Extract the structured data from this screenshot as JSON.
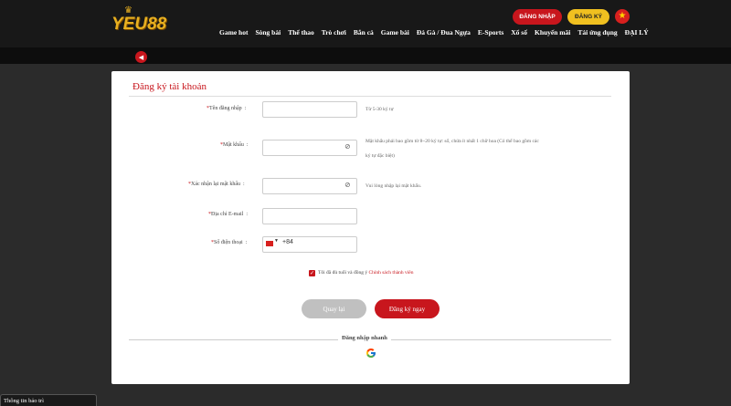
{
  "header": {
    "logo_text": "YEU88",
    "login_label": "ĐĂNG NHẬP",
    "register_label": "ĐĂNG KÝ",
    "nav": [
      "Game hot",
      "Sòng bài",
      "Thể thao",
      "Trò chơi",
      "Bắn cá",
      "Game bài",
      "Đá Gà / Đua Ngựa",
      "E-Sports",
      "Xổ số",
      "Khuyến mãi",
      "Tải ứng dụng",
      "ĐẠI LÝ"
    ]
  },
  "form": {
    "title": "Đăng ký tài khoản",
    "username_label": "Tên đăng nhập",
    "username_hint": "Từ 5-30 ký tự",
    "password_label": "Mật khẩu",
    "password_hint_1": "Mật khẩu phải bao gồm từ 8~20 ký tự: số, chứa ít nhất 1 chữ hoa (Có thể bao gồm các",
    "password_hint_2": "ký tự đặc biệt)",
    "confirm_label": "Xác nhận lại mật khẩu",
    "confirm_hint": "Vui lòng nhập lại mật khẩu.",
    "email_label": "Địa chỉ E-mail",
    "phone_label": "Số điện thoại",
    "phone_code": "+84",
    "agree_text": "Tôi đã đủ tuổi và đồng ý",
    "agree_link": "Chính sách thành viên",
    "back_label": "Quay lại",
    "submit_label": "Đăng ký ngay",
    "quick_login_label": "Đăng nhập nhanh"
  },
  "footer": {
    "maintenance_label": "Thông tin bảo trì"
  },
  "colors": {
    "brand_red": "#c8161d",
    "brand_yellow": "#f0c020"
  }
}
